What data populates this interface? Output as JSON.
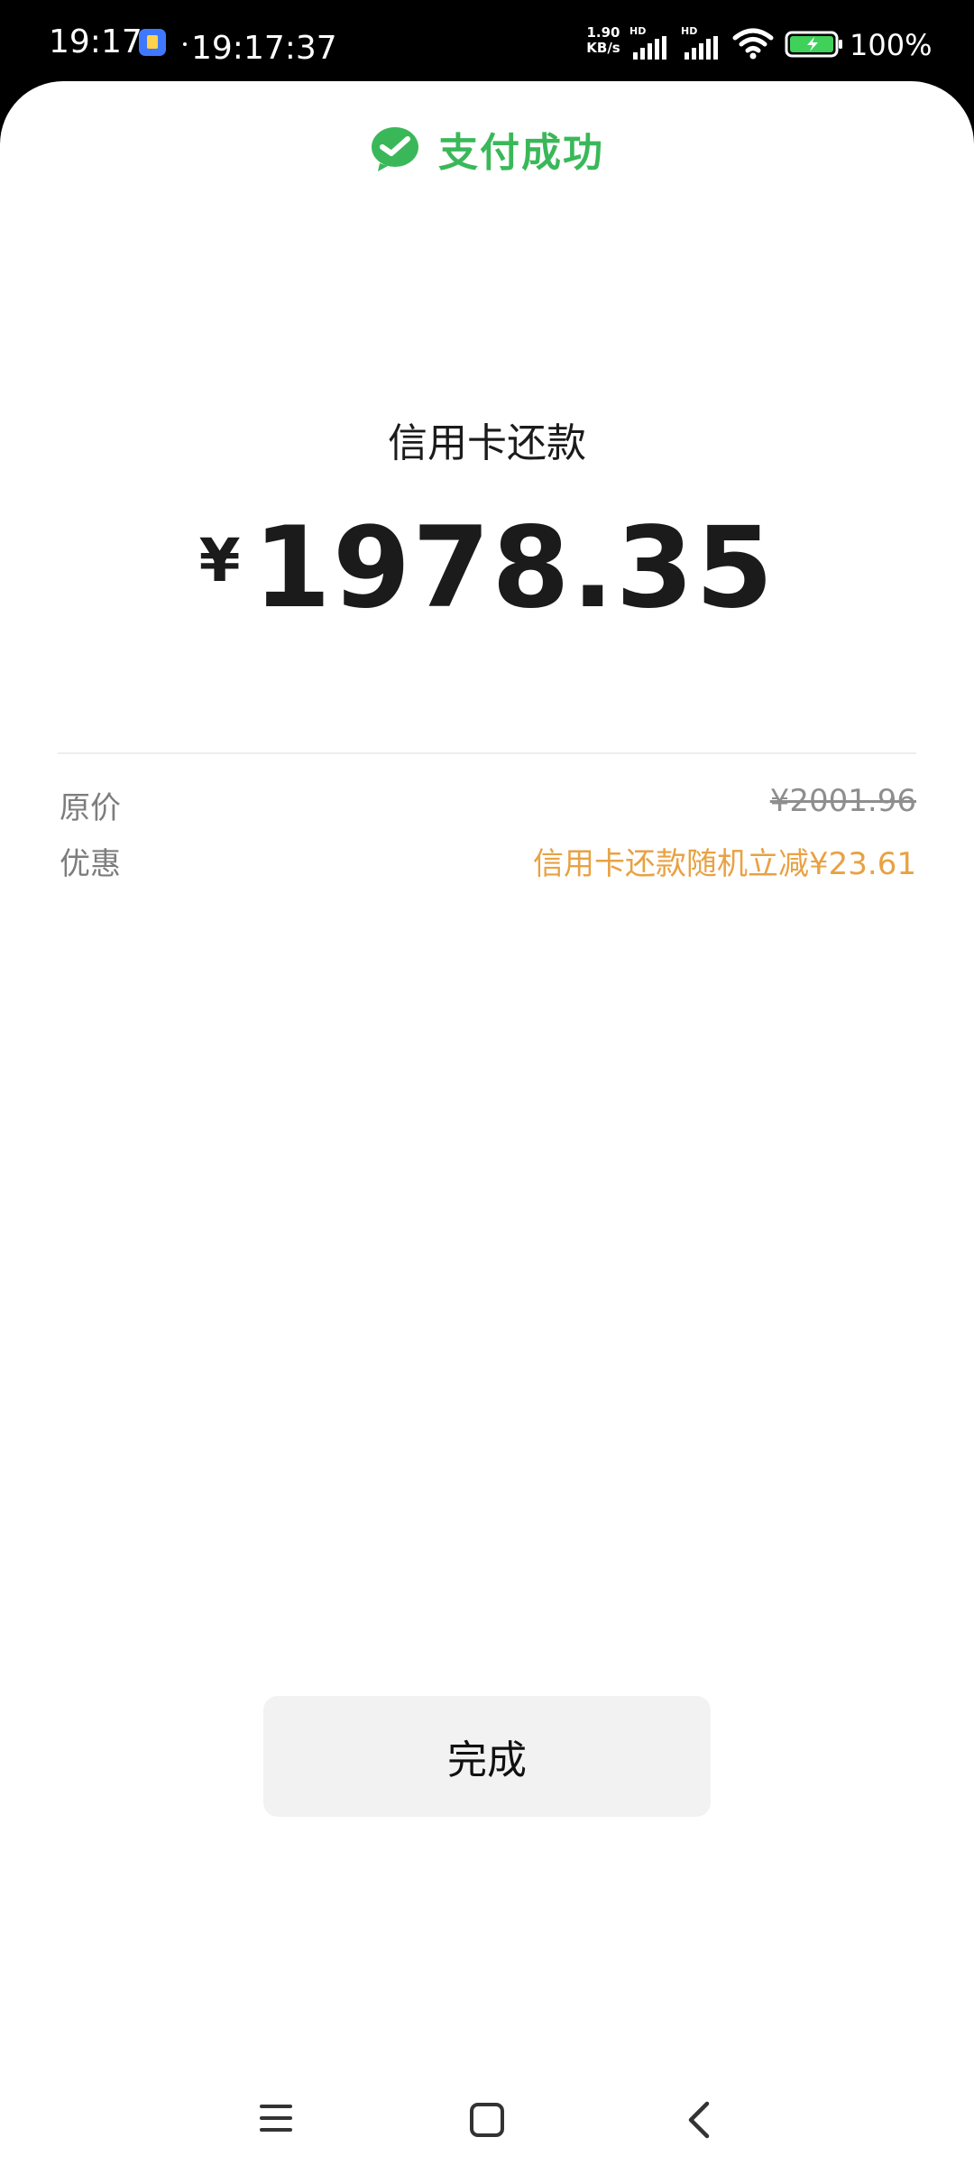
{
  "status_bar": {
    "time": "19:17",
    "clock": "19:17:37",
    "net_speed_value": "1.90",
    "net_speed_unit": "KB/s",
    "hd1": "HD",
    "hd2": "HD",
    "battery": "100%",
    "app_icon": "notes-app-icon"
  },
  "header": {
    "title": "支付成功",
    "icon": "wechat-pay-icon",
    "accent_color": "#3ab859"
  },
  "payment": {
    "title": "信用卡还款",
    "currency": "¥",
    "amount": "1978.35"
  },
  "details": [
    {
      "label": "原价",
      "value": "¥2001.96",
      "style": "strikethrough"
    },
    {
      "label": "优惠",
      "value": "信用卡还款随机立减¥23.61",
      "style": "promo",
      "color": "#e8a243"
    }
  ],
  "actions": {
    "done_label": "完成"
  },
  "nav_bar": {
    "menu_icon": "menu-icon",
    "home_icon": "home-icon",
    "back_icon": "back-icon"
  }
}
